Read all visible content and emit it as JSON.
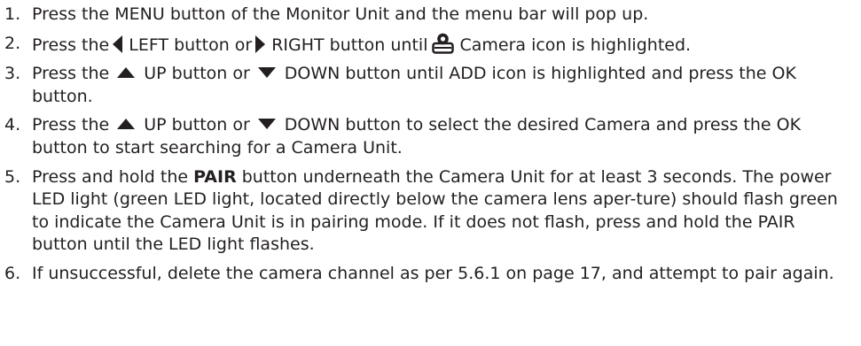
{
  "steps": [
    {
      "number": "1.",
      "text": "Press the MENU button of the Monitor Unit and the menu bar will pop up."
    },
    {
      "number": "2.",
      "a": "Press the",
      "b": "LEFT button or",
      "c": "RIGHT button until",
      "d": "Camera icon is highlighted."
    },
    {
      "number": "3.",
      "a": "Press the",
      "b": "UP button or",
      "c": "DOWN button until ADD icon is highlighted and press the OK button."
    },
    {
      "number": "4.",
      "a": "Press the",
      "b": "UP button or",
      "c": "DOWN button to select the desired Camera and press the OK button to start searching for a Camera Unit."
    },
    {
      "number": "5.",
      "a": "Press and hold the",
      "bold": "PAIR",
      "b": "button underneath the Camera Unit for at least 3 seconds. The power LED light (green LED light, located directly below the camera lens aper-ture) should flash green to indicate the Camera Unit is in pairing mode. If it does not flash, press and hold the PAIR button until the LED light flashes."
    },
    {
      "number": "6.",
      "text": "If unsuccessful, delete the camera channel as per 5.6.1 on page 17, and attempt to pair again."
    }
  ],
  "icons": {
    "left": "left-arrow-icon",
    "right": "right-arrow-icon",
    "up": "up-arrow-icon",
    "down": "down-arrow-icon",
    "camera": "camera-icon"
  }
}
